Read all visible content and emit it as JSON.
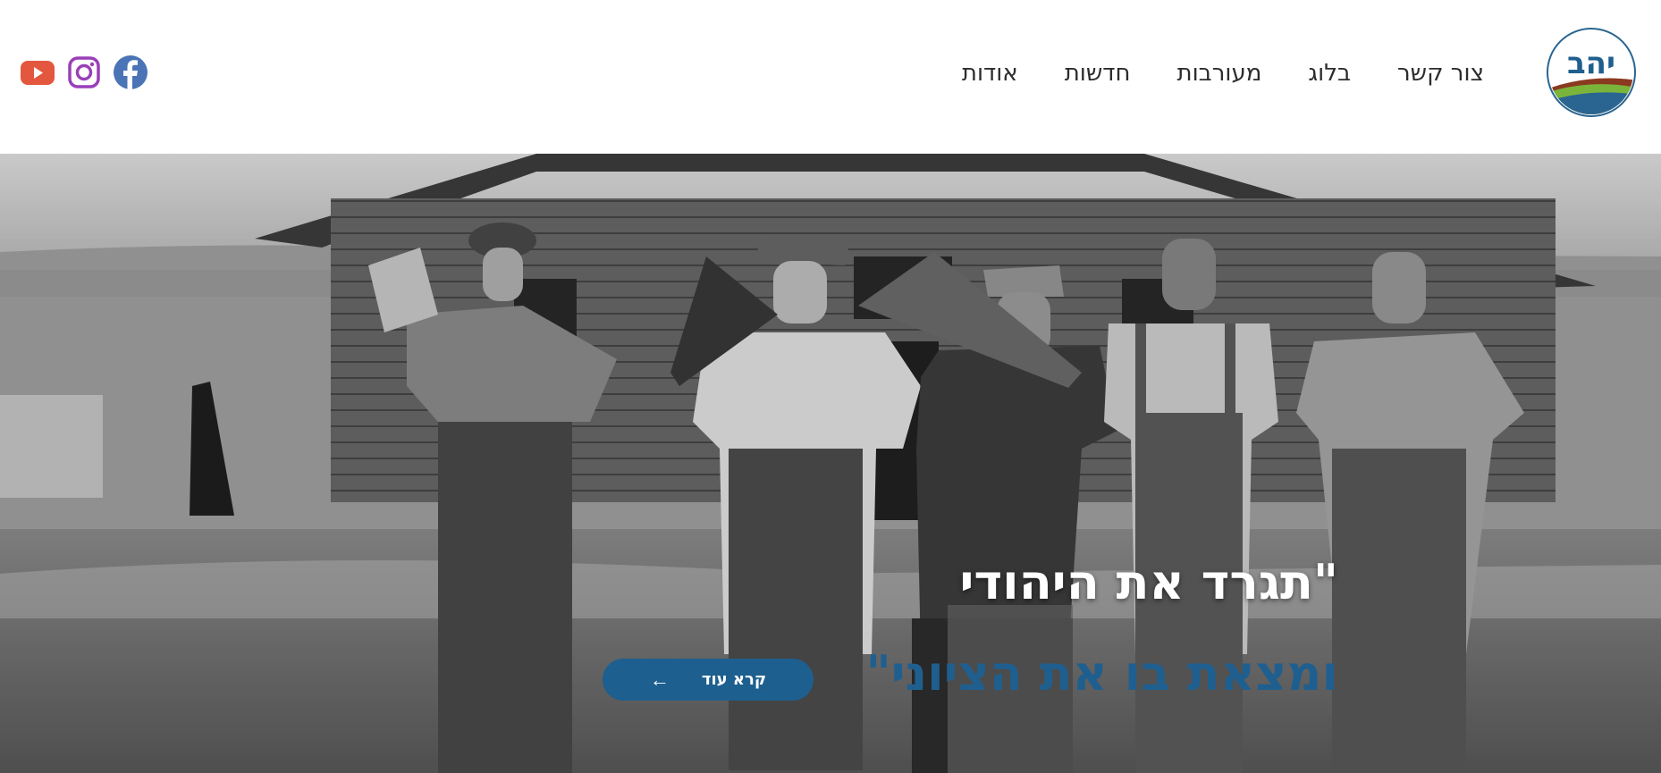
{
  "header": {
    "logo_text": "יהב",
    "nav": [
      "אודות",
      "חדשות",
      "מעורבות",
      "בלוג",
      "צור קשר"
    ]
  },
  "social": {
    "icons": [
      "facebook-icon",
      "instagram-icon",
      "youtube-icon"
    ],
    "colors": {
      "facebook": "#4a74b5",
      "instagram": "#9a3fb8",
      "youtube": "#e4573f"
    }
  },
  "hero": {
    "headline_line1": "\"תגרד את היהודי",
    "headline_line2": "ומצאת בו את הציוני\"",
    "cta_label": "קרא עוד",
    "cta_arrow": "←"
  },
  "colors": {
    "brand_blue": "#1d5f8f",
    "logo_green": "#7ab43a",
    "logo_brown": "#8a3a1f"
  }
}
